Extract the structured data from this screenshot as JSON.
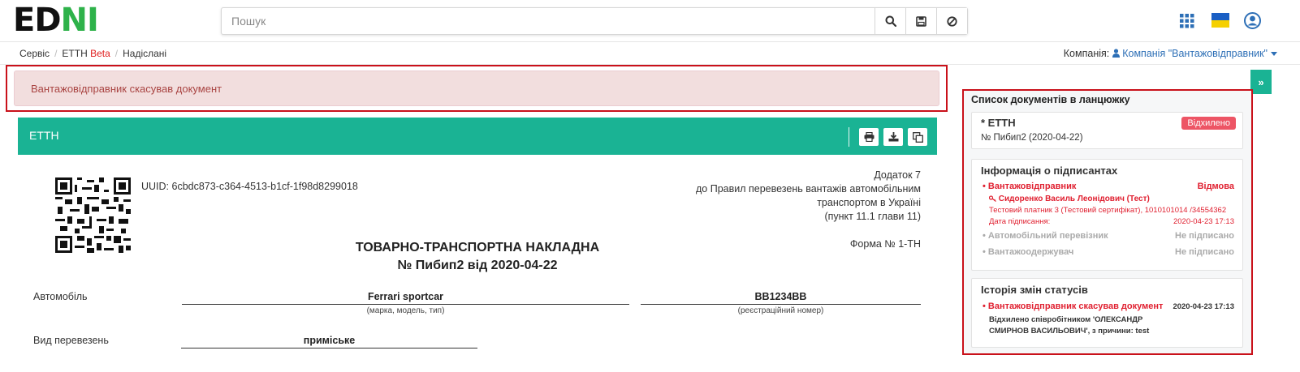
{
  "header": {
    "logo_left": "ED",
    "logo_right": "NI",
    "search_placeholder": "Пошук"
  },
  "breadcrumb": {
    "items": [
      "Сервіс",
      "ЕТТН",
      "Надіслані"
    ],
    "beta": "Beta",
    "separator": "/"
  },
  "company": {
    "label": "Компанія:",
    "value": "Компанія \"Вантажовідправник\""
  },
  "alert": {
    "text": "Вантажовідправник скасував документ"
  },
  "document": {
    "panel_title": "ЕТТН",
    "uuid": "UUID: 6cbdc873-c364-4513-b1cf-1f98d8299018",
    "appendix": [
      "Додаток 7",
      "до Правил перевезень вантажів автомобільним",
      "транспортом в Україні",
      "(пункт 11.1 глави 11)"
    ],
    "form_no": "Форма № 1-ТН",
    "title_line1": "ТОВАРНО-ТРАНСПОРТНА НАКЛАДНА",
    "title_line2": "№ Пибип2 від 2020-04-22",
    "car_label": "Автомобіль",
    "car_value": "Ferrari sportcar",
    "car_hint": "(марка, модель, тип)",
    "reg_value": "BB1234BB",
    "reg_hint": "(реєстраційний номер)",
    "transport_label": "Вид перевезень",
    "transport_value": "приміське"
  },
  "sidebar": {
    "title": "Список документів в ланцюжку",
    "chain_doc": {
      "name": "* ЕТТН",
      "status": "Відхилено",
      "number": "№ Пибип2 (2020-04-22)"
    },
    "signers": {
      "title": "Інформація о підписантах",
      "items": [
        {
          "role": "Вантажовідправник",
          "status": "Відмова",
          "person": "Сидоренко Василь Леонідович (Тест)",
          "cert": "Тестовий платник 3 (Тестовий сертифікат), 1010101014 /34554362",
          "date_label": "Дата підписання:",
          "date": "2020-04-23 17:13"
        },
        {
          "role": "Автомобільний перевізник",
          "status": "Не підписано"
        },
        {
          "role": "Вантажоодержувач",
          "status": "Не підписано"
        }
      ]
    },
    "history": {
      "title": "Історія змін статусів",
      "event": "Вантажовідправник скасував документ",
      "date": "2020-04-23 17:13",
      "detail_line1": "Відхилено співробітником 'ОЛЕКСАНДР",
      "detail_line2": "СМИРНОВ ВАСИЛЬОВИЧ', з причини: test"
    }
  },
  "colors": {
    "accent": "#1ab394",
    "danger": "#ed5565",
    "highlight": "#c9111a",
    "link": "#2d6fb6"
  }
}
